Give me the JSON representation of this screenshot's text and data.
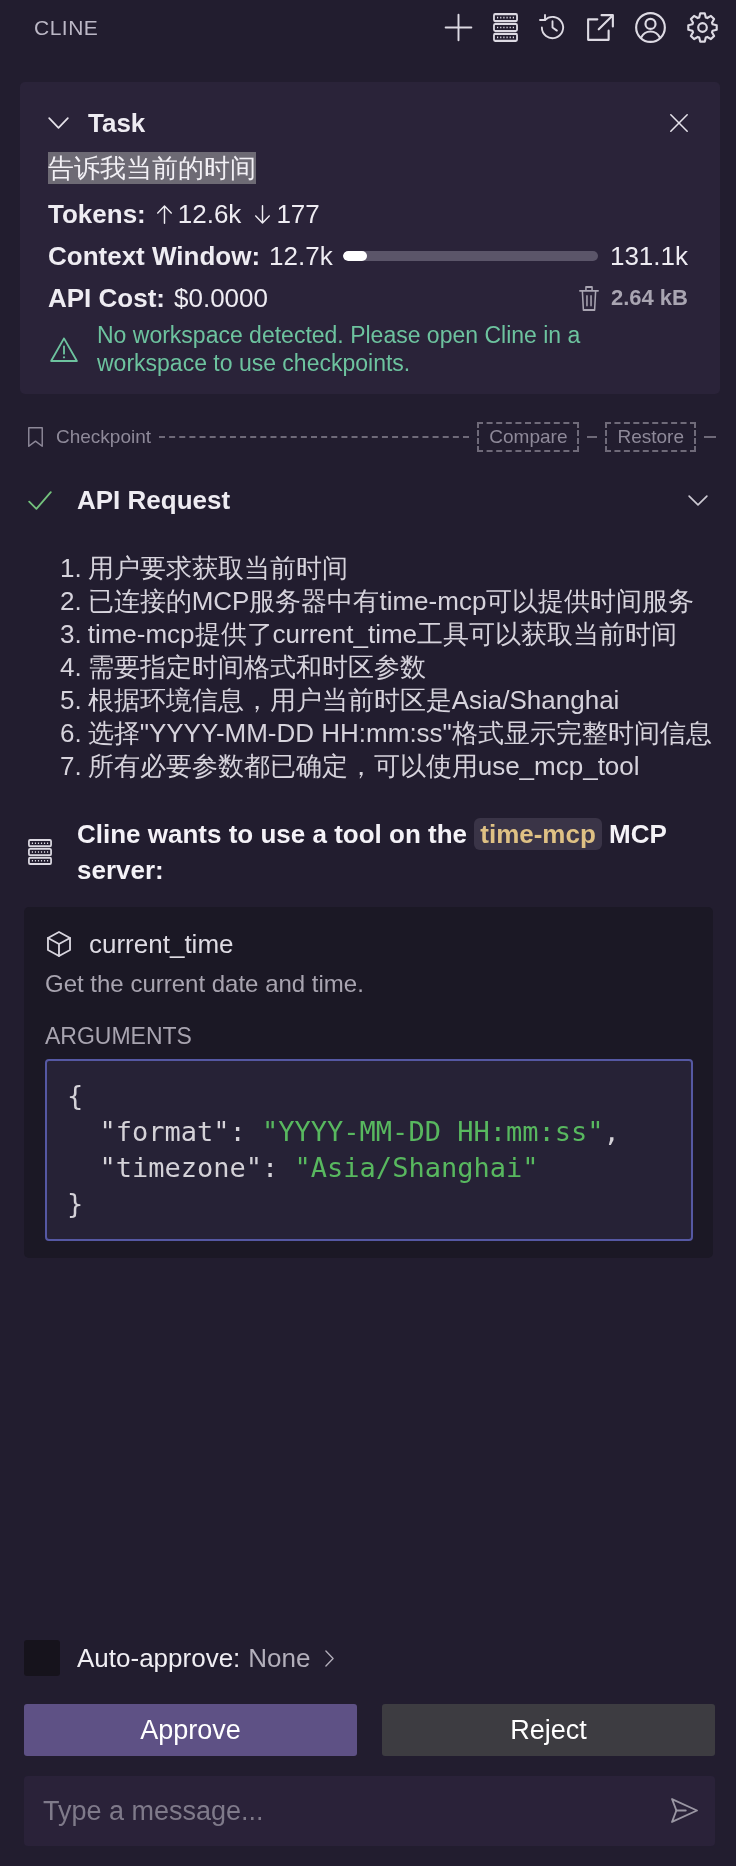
{
  "header": {
    "title": "CLINE"
  },
  "task": {
    "expanded": true,
    "title": "Task",
    "prompt": "告诉我当前的时间",
    "prompt_selected": true,
    "tokens": {
      "label": "Tokens:",
      "sent": "12.6k",
      "received": "177"
    },
    "context_window": {
      "label": "Context Window:",
      "used": "12.7k",
      "level": 0.097,
      "limit": "131.1k"
    },
    "api_cost": {
      "label": "API Cost:",
      "value": "$0.0000"
    },
    "storage": "2.64 kB",
    "warning": "No workspace detected. Please open Cline in a workspace to use checkpoints."
  },
  "checkpoint": {
    "label": "Checkpoint",
    "actions": [
      "Compare",
      "Restore"
    ]
  },
  "api_request": {
    "title": "API Request",
    "completed": true,
    "expanded": false
  },
  "message": {
    "steps": [
      {
        "number": "1.",
        "text": "用户要求获取当前时间"
      },
      {
        "number": "2.",
        "text": "已连接的MCP服务器中有time-mcp可以提供时间服务"
      },
      {
        "number": "3.",
        "text": "time-mcp提供了current_time工具可以获取当前时间"
      },
      {
        "number": "4.",
        "text": "需要指定时间格式和时区参数"
      },
      {
        "number": "5.",
        "text": "根据环境信息，用户当前时区是Asia/Shanghai"
      },
      {
        "number": "6.",
        "text": "选择\"YYYY-MM-DD HH:mm:ss\"格式显示完整时间信息"
      },
      {
        "number": "7.",
        "text": "所有必要参数都已确定，可以使用use_mcp_tool"
      }
    ]
  },
  "tool_request": {
    "text_before": "Cline wants to use a tool on the",
    "server": "time-mcp",
    "text_after": "MCP server:",
    "tool": {
      "name": "current_time",
      "description": "Get the current date and time.",
      "arguments_label": "ARGUMENTS",
      "code_lines": [
        [
          {
            "kind": "punct",
            "text": "{"
          }
        ],
        [
          {
            "kind": "key",
            "text": "  \"format\""
          },
          {
            "kind": "punct",
            "text": ": "
          },
          {
            "kind": "string",
            "text": "\"YYYY-MM-DD HH:mm:ss\""
          },
          {
            "kind": "punct",
            "text": ","
          }
        ],
        [
          {
            "kind": "key",
            "text": "  \"timezone\""
          },
          {
            "kind": "punct",
            "text": ": "
          },
          {
            "kind": "string",
            "text": "\"Asia/Shanghai\""
          }
        ],
        [
          {
            "kind": "punct",
            "text": "}"
          }
        ]
      ]
    }
  },
  "auto_approve": {
    "checked": false,
    "label": "Auto-approve:",
    "value": "None"
  },
  "actions": [
    {
      "label": "Approve",
      "kind": "primary"
    },
    {
      "label": "Reject",
      "kind": "secondary"
    }
  ],
  "composer": {
    "placeholder": "Type a message..."
  }
}
